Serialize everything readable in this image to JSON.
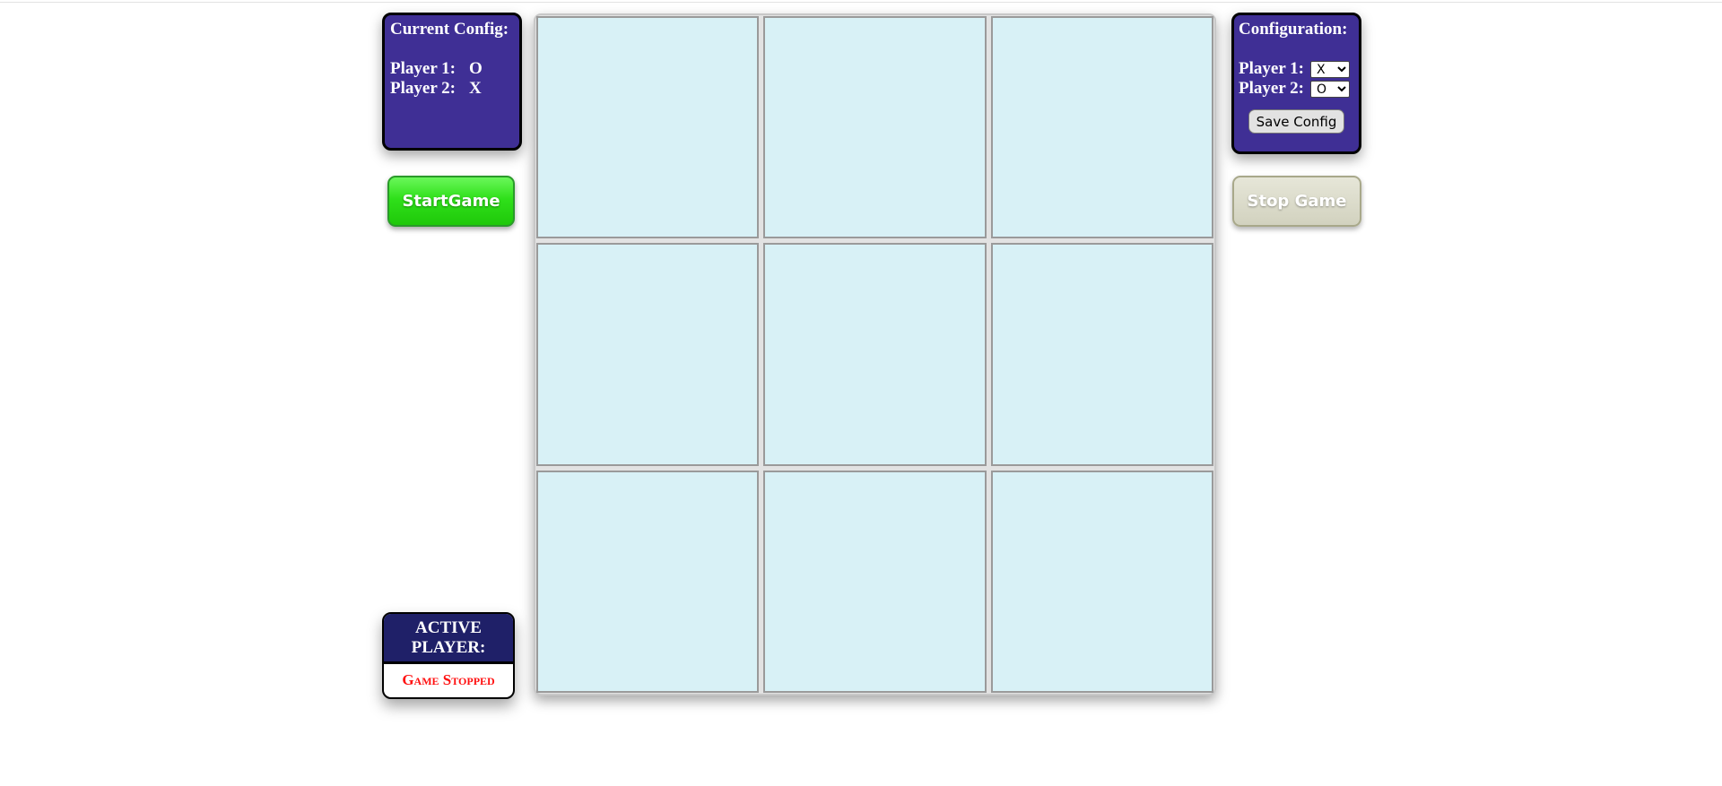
{
  "current_config": {
    "title": "Current Config:",
    "player1_label": "Player 1:",
    "player1_value": "O",
    "player2_label": "Player 2:",
    "player2_value": "X"
  },
  "controls": {
    "start_label": "StartGame",
    "stop_label": "Stop Game"
  },
  "active_player": {
    "title": "ACTIVE PLAYER:",
    "status": "Game Stopped"
  },
  "board": {
    "cells": [
      "",
      "",
      "",
      "",
      "",
      "",
      "",
      "",
      ""
    ]
  },
  "configuration": {
    "title": "Configuration:",
    "player1_label": "Player 1:",
    "player1_selected": "X",
    "player2_label": "Player 2:",
    "player2_selected": "O",
    "save_label": "Save Config"
  },
  "colors": {
    "panel_bg": "#3f2f95",
    "active_head_bg": "#1f2068",
    "cell_bg": "#d8f1f6",
    "start_green": "#2fe01a",
    "status_red": "#ff1010"
  }
}
